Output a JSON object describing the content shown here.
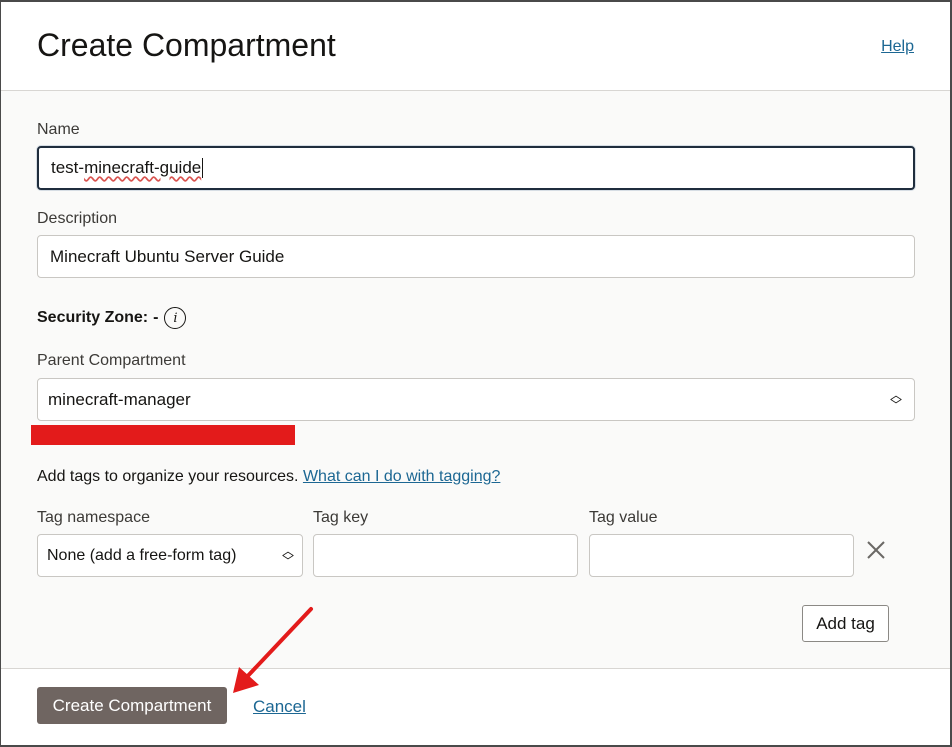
{
  "dialog": {
    "title": "Create Compartment",
    "help_label": "Help"
  },
  "form": {
    "name_label": "Name",
    "name_value": "test-minecraft-guide",
    "name_prefix": "test-",
    "name_misspelled": "minecraft-guide",
    "description_label": "Description",
    "description_value": "Minecraft Ubuntu Server Guide",
    "security_zone_label": "Security Zone:",
    "security_zone_value": "-",
    "info_icon_glyph": "i",
    "parent_compartment_label": "Parent Compartment",
    "parent_compartment_value": "minecraft-manager"
  },
  "tags": {
    "intro_text": "Add tags to organize your resources.",
    "intro_link": "What can I do with tagging?",
    "namespace_label": "Tag namespace",
    "namespace_value": "None (add a free-form tag)",
    "key_label": "Tag key",
    "key_value": "",
    "value_label": "Tag value",
    "value_value": "",
    "add_tag_label": "Add tag"
  },
  "footer": {
    "create_label": "Create Compartment",
    "cancel_label": "Cancel"
  },
  "colors": {
    "primary_button": "#6f6561",
    "link": "#1c6793",
    "redaction": "#e31b1b",
    "annotation_arrow": "#e31b1b"
  },
  "icons": [
    "info-icon",
    "select-chevron-icon",
    "close-icon",
    "annotation-arrow-icon"
  ]
}
